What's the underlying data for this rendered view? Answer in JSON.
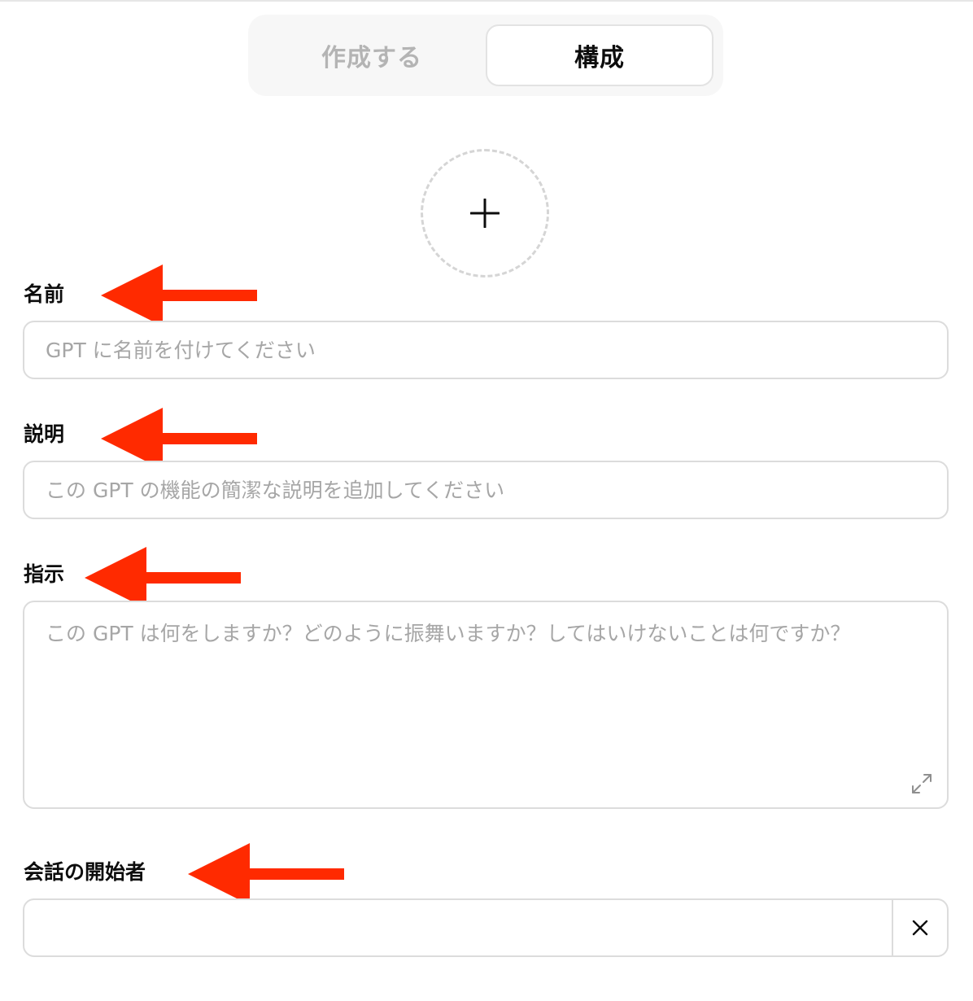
{
  "tabs": {
    "create": "作成する",
    "configure": "構成",
    "active": "configure"
  },
  "avatar": {
    "icon": "plus-icon"
  },
  "fields": {
    "name": {
      "label": "名前",
      "placeholder": "GPT に名前を付けてください",
      "value": ""
    },
    "description": {
      "label": "説明",
      "placeholder": "この GPT の機能の簡潔な説明を追加してください",
      "value": ""
    },
    "instructions": {
      "label": "指示",
      "placeholder": "この GPT は何をしますか？どのように振舞いますか？してはいけないことは何ですか？",
      "value": "",
      "expand_icon": "expand-icon"
    },
    "conversation_starters": {
      "label": "会話の開始者",
      "value": "",
      "clear_icon": "close-icon"
    }
  },
  "annotations": {
    "arrow_color": "#ff2a00",
    "arrow_icon": "left-arrow-icon"
  },
  "colors": {
    "text": "#0d0d0d",
    "placeholder": "#a6a6a6",
    "border": "#dcdcdc",
    "tab_track": "#f7f7f7",
    "tab_inactive": "#b4b4b4"
  }
}
